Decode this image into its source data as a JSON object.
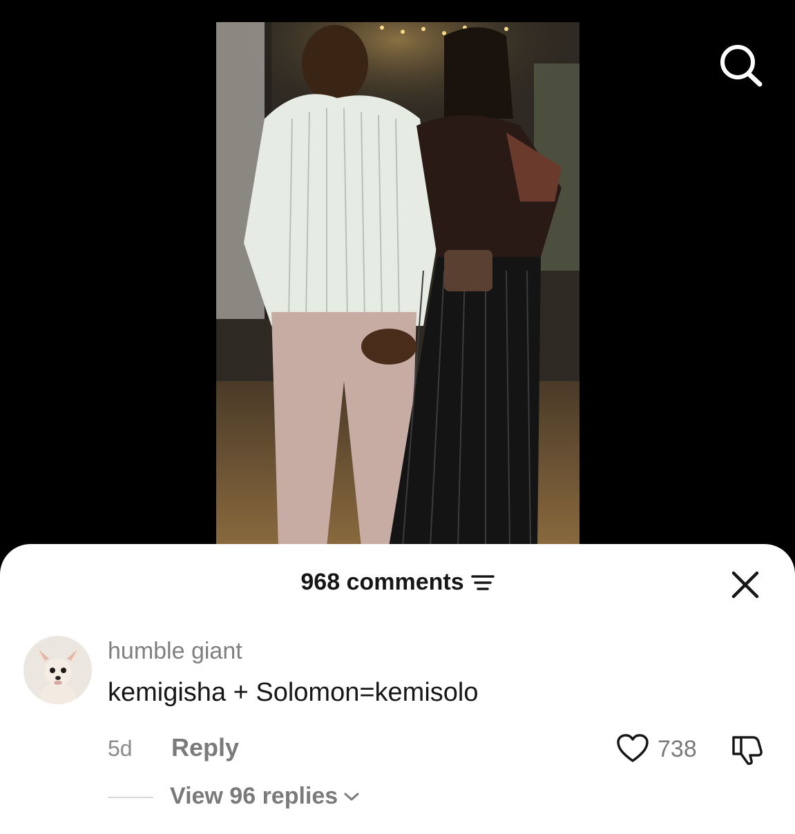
{
  "video": {
    "scene": "video-frame"
  },
  "top_bar": {
    "search_icon": "search-icon"
  },
  "comments_sheet": {
    "title": "968 comments",
    "filter_icon": "filter-icon",
    "close_icon": "close-icon"
  },
  "comment": {
    "username": "humble giant",
    "text": "kemigisha + Solomon=kemisolo",
    "time": "5d",
    "reply_label": "Reply",
    "likes": "738",
    "like_icon": "heart-icon",
    "dislike_icon": "dislike-icon",
    "view_replies": "View 96 replies",
    "chevron_icon": "chevron-down-icon"
  },
  "colors": {
    "sheet_bg": "#ffffff",
    "text_primary": "#161616",
    "text_secondary": "#7a7a7a",
    "background": "#000000"
  }
}
